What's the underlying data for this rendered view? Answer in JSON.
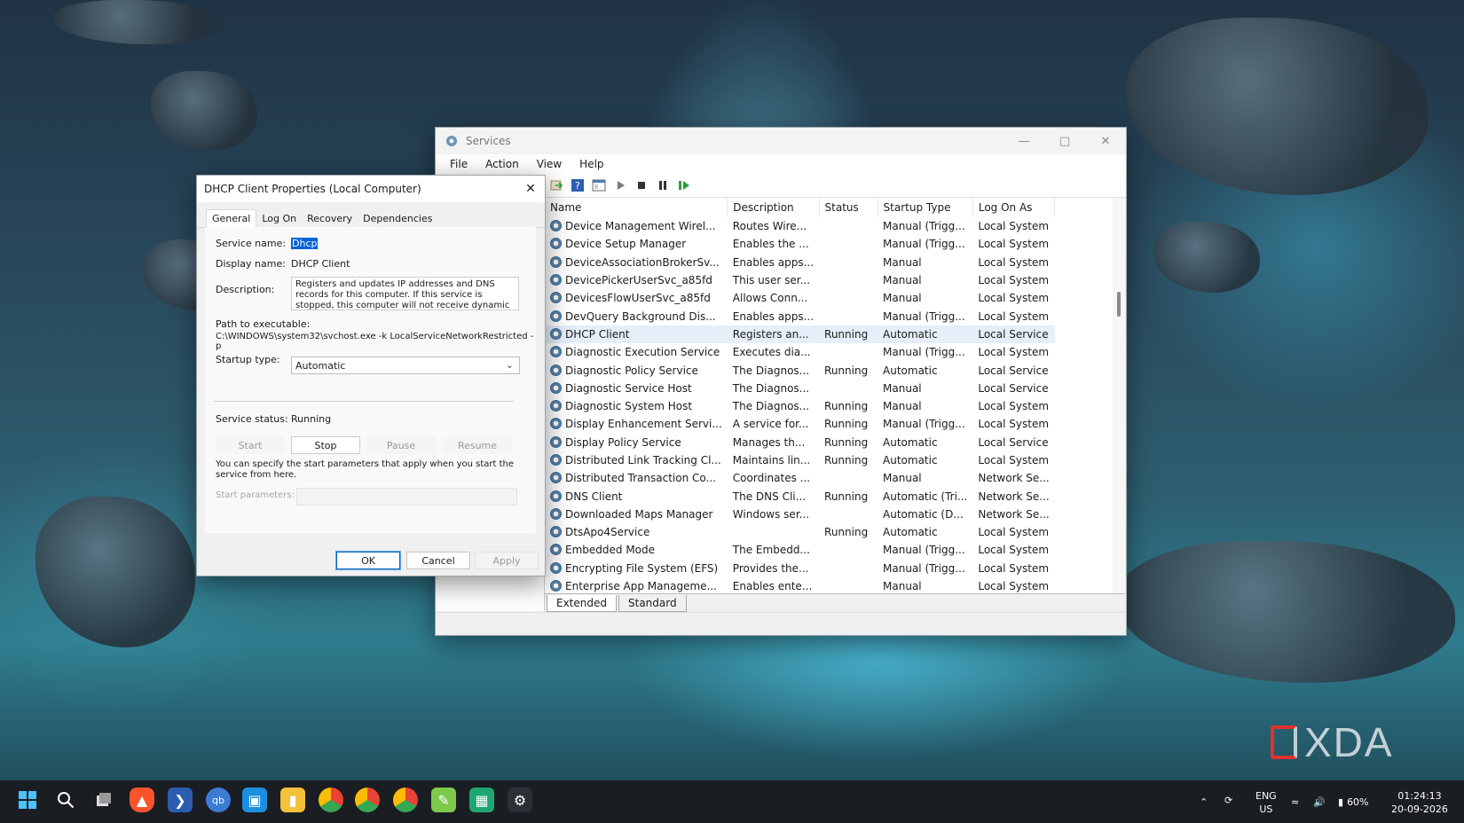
{
  "services_window": {
    "title": "Services",
    "menu": [
      "File",
      "Action",
      "View",
      "Help"
    ],
    "columns": [
      "Name",
      "Description",
      "Status",
      "Startup Type",
      "Log On As"
    ],
    "rows": [
      {
        "name": "Device Management Wirel...",
        "description": "Routes Wire...",
        "status": "",
        "startup": "Manual (Trigg...",
        "logon": "Local System"
      },
      {
        "name": "Device Setup Manager",
        "description": "Enables the ...",
        "status": "",
        "startup": "Manual (Trigg...",
        "logon": "Local System"
      },
      {
        "name": "DeviceAssociationBrokerSv...",
        "description": "Enables apps...",
        "status": "",
        "startup": "Manual",
        "logon": "Local System"
      },
      {
        "name": "DevicePickerUserSvc_a85fd",
        "description": "This user ser...",
        "status": "",
        "startup": "Manual",
        "logon": "Local System"
      },
      {
        "name": "DevicesFlowUserSvc_a85fd",
        "description": "Allows Conn...",
        "status": "",
        "startup": "Manual",
        "logon": "Local System"
      },
      {
        "name": "DevQuery Background Dis...",
        "description": "Enables apps...",
        "status": "",
        "startup": "Manual (Trigg...",
        "logon": "Local System"
      },
      {
        "name": "DHCP Client",
        "description": "Registers an...",
        "status": "Running",
        "startup": "Automatic",
        "logon": "Local Service"
      },
      {
        "name": "Diagnostic Execution Service",
        "description": "Executes dia...",
        "status": "",
        "startup": "Manual (Trigg...",
        "logon": "Local System"
      },
      {
        "name": "Diagnostic Policy Service",
        "description": "The Diagnos...",
        "status": "Running",
        "startup": "Automatic",
        "logon": "Local Service"
      },
      {
        "name": "Diagnostic Service Host",
        "description": "The Diagnos...",
        "status": "",
        "startup": "Manual",
        "logon": "Local Service"
      },
      {
        "name": "Diagnostic System Host",
        "description": "The Diagnos...",
        "status": "Running",
        "startup": "Manual",
        "logon": "Local System"
      },
      {
        "name": "Display Enhancement Servi...",
        "description": "A service for...",
        "status": "Running",
        "startup": "Manual (Trigg...",
        "logon": "Local System"
      },
      {
        "name": "Display Policy Service",
        "description": "Manages th...",
        "status": "Running",
        "startup": "Automatic",
        "logon": "Local Service"
      },
      {
        "name": "Distributed Link Tracking Cl...",
        "description": "Maintains lin...",
        "status": "Running",
        "startup": "Automatic",
        "logon": "Local System"
      },
      {
        "name": "Distributed Transaction Co...",
        "description": "Coordinates ...",
        "status": "",
        "startup": "Manual",
        "logon": "Network Se..."
      },
      {
        "name": "DNS Client",
        "description": "The DNS Cli...",
        "status": "Running",
        "startup": "Automatic (Tri...",
        "logon": "Network Se..."
      },
      {
        "name": "Downloaded Maps Manager",
        "description": "Windows ser...",
        "status": "",
        "startup": "Automatic (D...",
        "logon": "Network Se..."
      },
      {
        "name": "DtsApo4Service",
        "description": "",
        "status": "Running",
        "startup": "Automatic",
        "logon": "Local System"
      },
      {
        "name": "Embedded Mode",
        "description": "The Embedd...",
        "status": "",
        "startup": "Manual (Trigg...",
        "logon": "Local System"
      },
      {
        "name": "Encrypting File System (EFS)",
        "description": "Provides the...",
        "status": "",
        "startup": "Manual (Trigg...",
        "logon": "Local System"
      },
      {
        "name": "Enterprise App Manageme...",
        "description": "Enables ente...",
        "status": "",
        "startup": "Manual",
        "logon": "Local System"
      }
    ],
    "selected_index": 6,
    "bottom_tabs": [
      "Extended",
      "Standard"
    ]
  },
  "dialog": {
    "title": "DHCP Client Properties (Local Computer)",
    "tabs": [
      "General",
      "Log On",
      "Recovery",
      "Dependencies"
    ],
    "service_name_label": "Service name:",
    "service_name": "Dhcp",
    "display_name_label": "Display name:",
    "display_name": "DHCP Client",
    "description_label": "Description:",
    "description": "Registers and updates IP addresses and DNS records for this computer. If this service is stopped, this computer will not receive dynamic IP addresses",
    "path_label": "Path to executable:",
    "path": "C:\\WINDOWS\\system32\\svchost.exe -k LocalServiceNetworkRestricted -p",
    "startup_type_label": "Startup type:",
    "startup_type": "Automatic",
    "service_status_label": "Service status:",
    "service_status": "Running",
    "buttons": {
      "start": "Start",
      "stop": "Stop",
      "pause": "Pause",
      "resume": "Resume"
    },
    "hint": "You can specify the start parameters that apply when you start the service from here.",
    "start_params_label": "Start parameters:",
    "ok": "OK",
    "cancel": "Cancel",
    "apply": "Apply"
  },
  "watermark": "XDA",
  "taskbar": {
    "language": "ENG",
    "region": "US",
    "battery": "60%",
    "time": "01:24:13",
    "date": "20-09-2026"
  },
  "colors": {
    "selection": "#0063d7",
    "accent": "#0067c0",
    "taskbar": "#1a1d22"
  }
}
